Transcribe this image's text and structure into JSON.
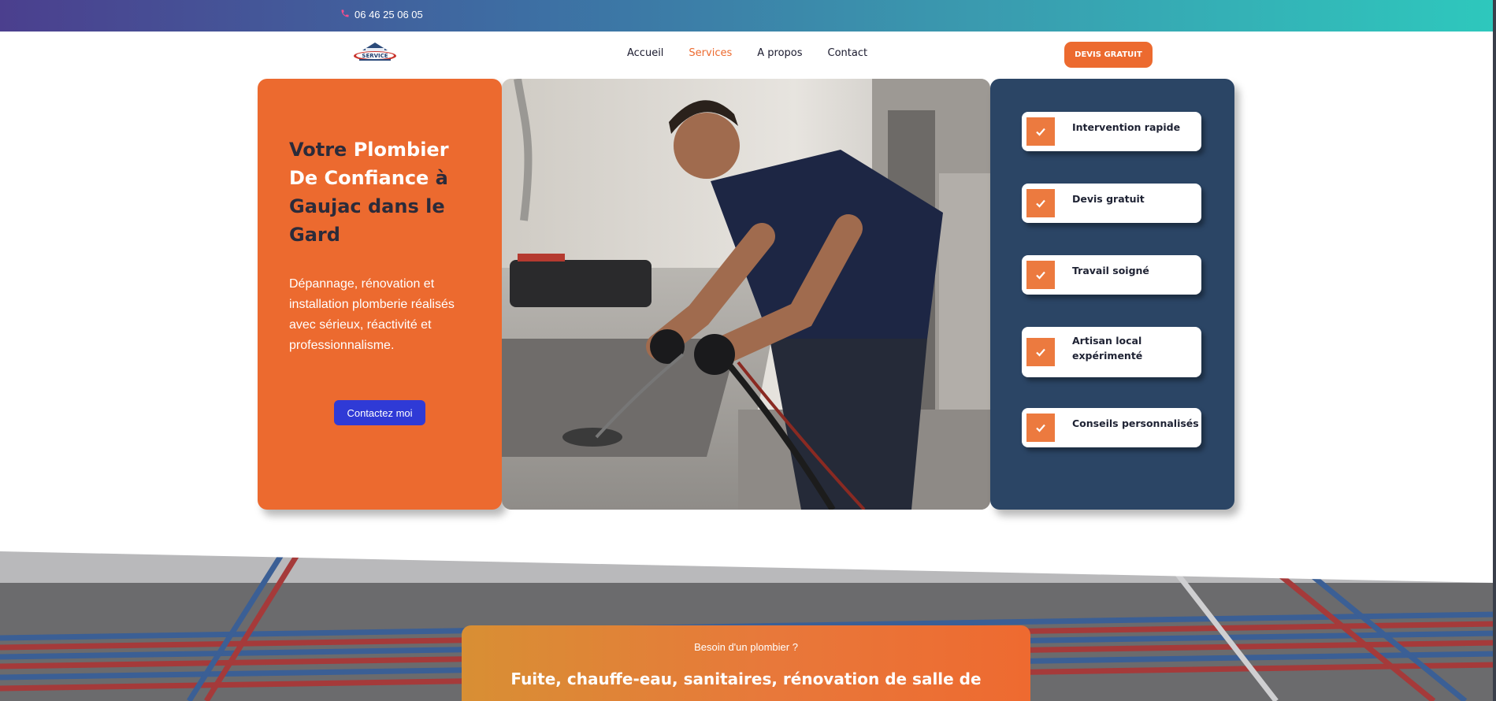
{
  "topbar": {
    "phone": "06 46 25 06 05"
  },
  "nav": {
    "items": [
      "Accueil",
      "Services",
      "A propos",
      "Contact"
    ],
    "cta": "DEVIS GRATUIT",
    "logo_text": "SERVICE"
  },
  "hero": {
    "title_part1": "Votre ",
    "title_part2": "Plombier De Confiance",
    "title_part3": " à Gaujac dans le Gard",
    "description": "Dépannage, rénovation et installation plomberie réalisés avec sérieux, réactivité et professionnalisme.",
    "button": "Contactez moi"
  },
  "features": [
    "Intervention rapide",
    "Devis gratuit",
    "Travail soigné",
    "Artisan local expérimenté",
    "Conseils personnalisés"
  ],
  "banner": {
    "kicker": "Besoin d'un plombier ?",
    "headline": "Fuite, chauffe-eau, sanitaires, rénovation de salle de"
  },
  "colors": {
    "accent": "#ec6a2f",
    "navy": "#2b4565",
    "button_blue": "#2f3ad6"
  }
}
